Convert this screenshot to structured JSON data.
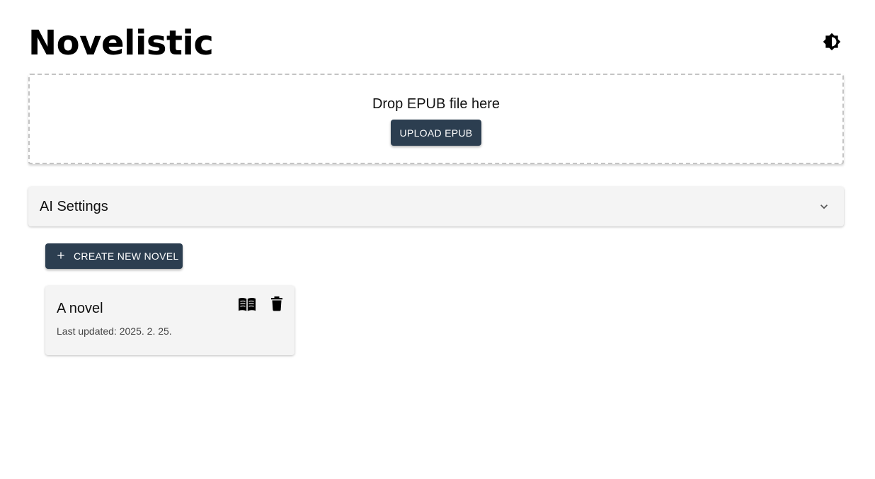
{
  "header": {
    "title": "Novelistic",
    "theme_icon": "brightness-icon"
  },
  "upload": {
    "drop_text": "Drop EPUB file here",
    "button_label": "UPLOAD EPUB"
  },
  "ai_settings": {
    "title": "AI Settings",
    "expanded": false,
    "icon": "chevron-down-icon"
  },
  "create_button": {
    "label": "CREATE NEW NOVEL",
    "icon": "plus-icon"
  },
  "novels": [
    {
      "title": "A novel",
      "last_updated": "Last updated: 2025. 2. 25.",
      "actions": [
        "book-open-icon",
        "trash-icon"
      ]
    }
  ],
  "colors": {
    "primary_button": "#2c3e50",
    "card_background": "#f4f4f4",
    "dropzone_border": "#c4c4c4"
  }
}
